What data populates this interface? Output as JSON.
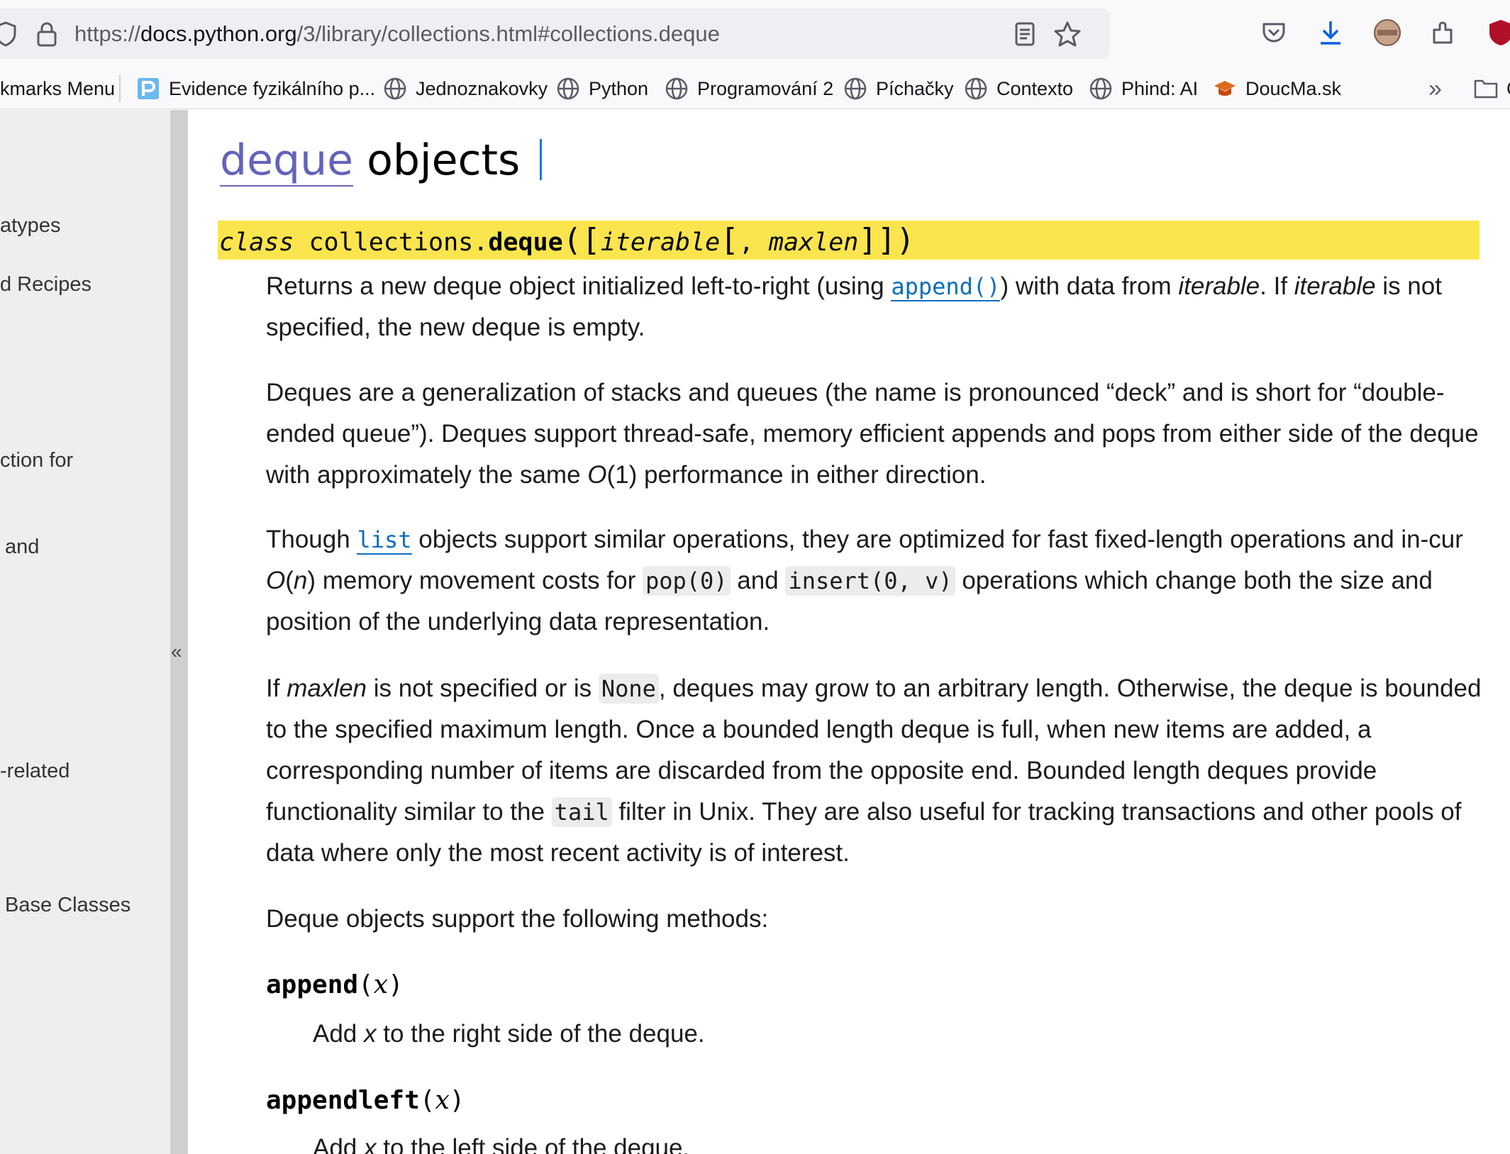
{
  "browser": {
    "url_scheme": "https://",
    "url_host": "docs.python.org",
    "url_path": "/3/library/collections.html#collections.deque",
    "bookmarks": [
      {
        "label": "kmarks Menu"
      },
      {
        "label": "Evidence fyzikálního p..."
      },
      {
        "label": "Jednoznakovky"
      },
      {
        "label": "Python"
      },
      {
        "label": "Programování 2"
      },
      {
        "label": "Píchačky"
      },
      {
        "label": "Contexto"
      },
      {
        "label": "Phind: AI"
      },
      {
        "label": "DoucMa.sk"
      }
    ],
    "overflow_chevron": "»",
    "folder_label": "C"
  },
  "sidebar": {
    "items": [
      "atypes",
      "d Recipes",
      "ction for",
      "and",
      "-related",
      "Base Classes"
    ],
    "collapse_glyph": "«"
  },
  "doc": {
    "heading_link": "deque",
    "heading_rest": "objects",
    "signature": {
      "keyword": "class",
      "module": "collections.",
      "name": "deque",
      "open": "(",
      "lbr1": "[",
      "param1": "iterable",
      "lbr2": "[",
      "sep": ", ",
      "param2": "maxlen",
      "rbr": "]]",
      "close": ")"
    },
    "p1": {
      "a": "Returns a new deque object initialized left-to-right (using ",
      "link": "append()",
      "b": ") with data from ",
      "i1": "iterable",
      "c": ". If ",
      "i2": "iterable",
      "d": " is not specified, the new deque is empty."
    },
    "p2": {
      "a": "Deques are a generalization of stacks and queues (the name is pronounced “deck” and is short for “double-ended queue”). Deques support thread-safe, memory efficient appends and pops from either side of the deque with approximately the same ",
      "o": "O",
      "b": "(1) performance in either direction."
    },
    "p3": {
      "a": "Though ",
      "link": "list",
      "b": " objects support similar operations, they are optimized for fast fixed-length operations and in-cur ",
      "o": "O",
      "c": "(",
      "n": "n",
      "d": ") memory movement costs for ",
      "code1": "pop(0)",
      "e": " and ",
      "code2": "insert(0, v)",
      "f": " operations which change both the size and position of the underlying data representation."
    },
    "p4": {
      "a": "If ",
      "i": "maxlen",
      "b": " is not specified or is ",
      "code1": "None",
      "c": ", deques may grow to an arbitrary length. Otherwise, the deque is bounded to the specified maximum length. Once a bounded length deque is full, when new items are added, a corresponding number of items are discarded from the opposite end. Bounded length deques provide functionality similar to the ",
      "code2": "tail",
      "d": " filter in Unix. They are also useful for tracking transactions and other pools of data where only the most recent activity is of interest."
    },
    "p5": "Deque objects support the following methods:",
    "methods": [
      {
        "name": "append",
        "open": "(",
        "arg": "x",
        "close": ")",
        "desc_a": "Add ",
        "desc_i": "x",
        "desc_b": " to the right side of the deque."
      },
      {
        "name": "appendleft",
        "open": "(",
        "arg": "x",
        "close": ")",
        "desc_a": "Add ",
        "desc_i": "x",
        "desc_b": " to the left side of the deque."
      }
    ]
  },
  "colors": {
    "signature_highlight": "#fbe54e",
    "link": "#0a6ebd",
    "heading_link": "#6363bb"
  }
}
